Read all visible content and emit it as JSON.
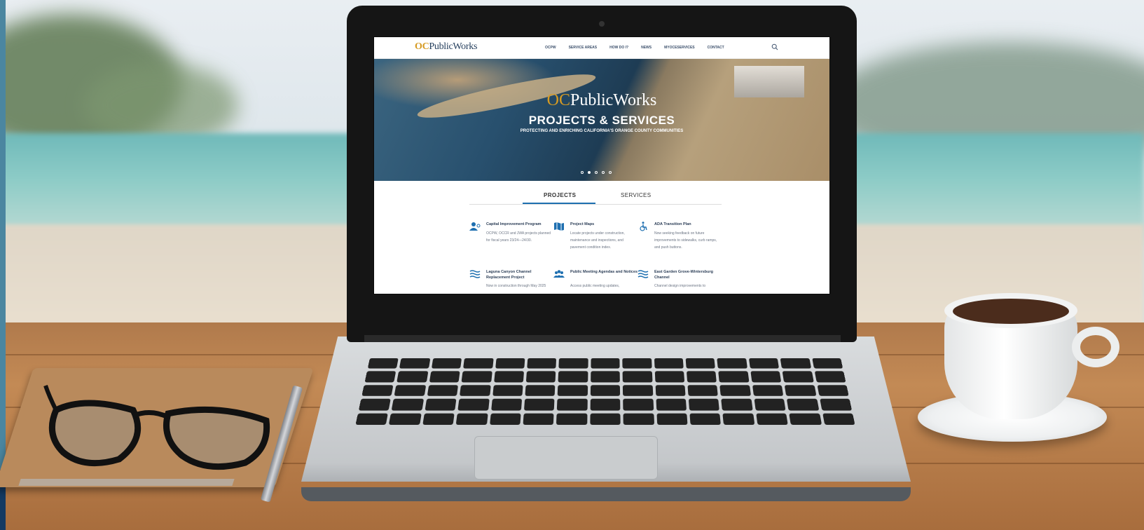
{
  "site": {
    "logo_oc": "OC",
    "logo_text": "PublicWorks",
    "nav": [
      "OCPW",
      "SERVICE AREAS",
      "HOW DO I?",
      "NEWS",
      "MYOCESERVICES",
      "CONTACT"
    ],
    "search_icon": "search-icon"
  },
  "hero": {
    "logo_oc": "OC",
    "logo_text": "PublicWorks",
    "title": "PROJECTS & SERVICES",
    "subtitle": "PROTECTING AND ENRICHING CALIFORNIA'S ORANGE COUNTY COMMUNITIES",
    "slide_count": 5,
    "active_slide": 2
  },
  "tabs": {
    "projects": "PROJECTS",
    "services": "SERVICES",
    "active": "projects",
    "accent": "#1e6fb0"
  },
  "cards": [
    {
      "icon": "users-icon",
      "title": "Capital Improvement Program",
      "desc": "OCPW, OCCR and JWA projects planned for fiscal years 23/24—24/30."
    },
    {
      "icon": "map-icon",
      "title": "Project Maps",
      "desc": "Locate projects under construction, maintenance and inspections, and pavement condition index."
    },
    {
      "icon": "wheelchair-icon",
      "title": "ADA Transition Plan",
      "desc": "Now seeking feedback on future improvements to sidewalks, curb ramps, and push buttons."
    },
    {
      "icon": "water-icon",
      "title": "Laguna Canyon Channel Replacement Project",
      "desc": "Now in construction through May 2025"
    },
    {
      "icon": "group-icon",
      "title": "Public Meeting Agendas and Notices",
      "desc": "Access public meeting updates,"
    },
    {
      "icon": "water-icon",
      "title": "East Garden Grove-Wintersburg Channel",
      "desc": "Channel design improvements to"
    }
  ],
  "colors": {
    "brand_navy": "#27415f",
    "brand_gold": "#d69b23",
    "icon_blue": "#1e6fb0"
  }
}
